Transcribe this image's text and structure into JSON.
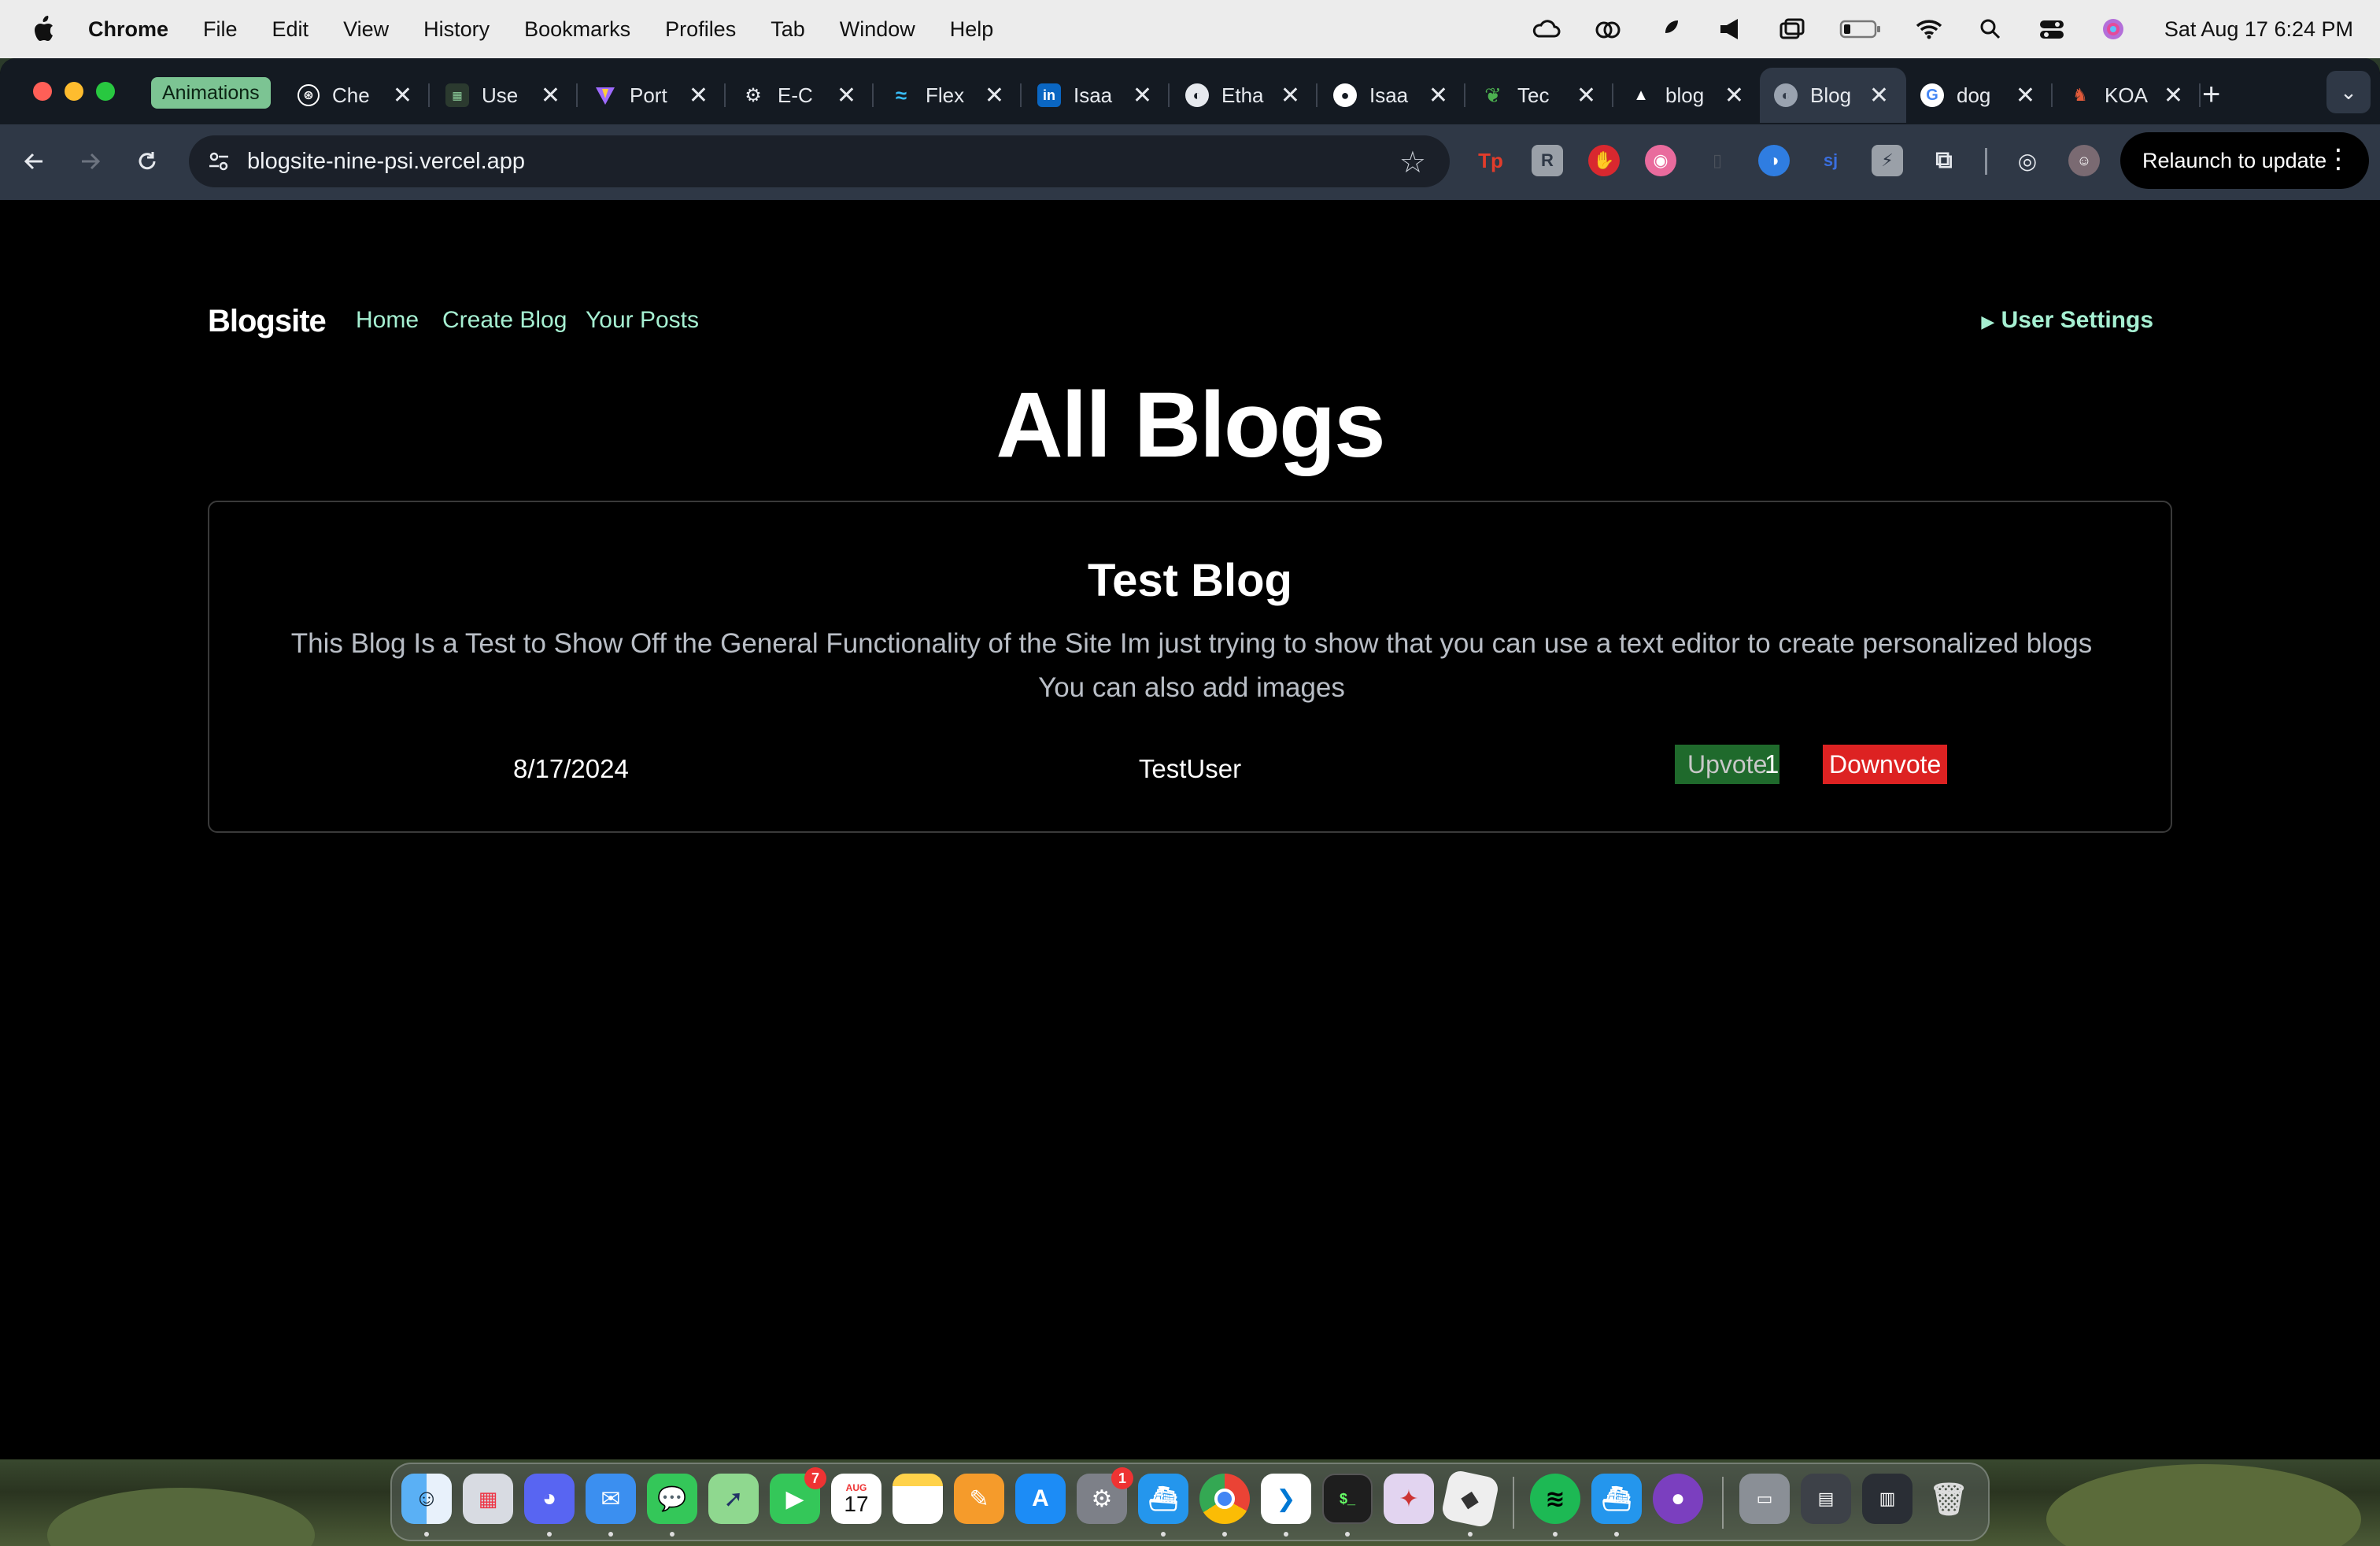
{
  "menubar": {
    "app_name": "Chrome",
    "menus": [
      "File",
      "Edit",
      "View",
      "History",
      "Bookmarks",
      "Profiles",
      "Tab",
      "Window",
      "Help"
    ],
    "clock": "Sat Aug 17  6:24 PM"
  },
  "tabs": {
    "group_label": "Animations",
    "items": [
      {
        "title": "Che",
        "icon": "openai-icon"
      },
      {
        "title": "Use",
        "icon": "spreadsheet-icon"
      },
      {
        "title": "Port",
        "icon": "vite-icon"
      },
      {
        "title": "E-C",
        "icon": "settings-icon"
      },
      {
        "title": "Flex",
        "icon": "tailwind-icon"
      },
      {
        "title": "Isaa",
        "icon": "linkedin-icon"
      },
      {
        "title": "Etha",
        "icon": "globe-icon"
      },
      {
        "title": "Isaa",
        "icon": "github-icon"
      },
      {
        "title": "Tec",
        "icon": "mongodb-icon"
      },
      {
        "title": "blog",
        "icon": "vercel-icon"
      },
      {
        "title": "Blog",
        "icon": "globe-icon",
        "active": true
      },
      {
        "title": "dog",
        "icon": "google-icon"
      },
      {
        "title": "KOA",
        "icon": "koa-icon"
      }
    ]
  },
  "toolbar": {
    "url": "blogsite-nine-psi.vercel.app",
    "relaunch_label": "Relaunch to update"
  },
  "site": {
    "brand": "Blogsite",
    "nav": {
      "home": "Home",
      "create": "Create Blog",
      "posts": "Your Posts"
    },
    "user_settings": "User Settings",
    "page_title": "All Blogs",
    "post": {
      "title": "Test Blog",
      "body_line1": "This Blog Is a Test to Show Off the General Functionality of the Site Im just trying to show that you can use a text editor to create personalized blogs",
      "body_line2": "You can also add images",
      "date": "8/17/2024",
      "author": "TestUser",
      "upvote_label": "Upvote",
      "score": "1",
      "downvote_label": "Downvote"
    }
  },
  "dock": {
    "calendar_month": "AUG",
    "calendar_day": "17",
    "facetime_badge": "7",
    "settings_badge": "1"
  },
  "colors": {
    "link": "#a6f0d2",
    "upvote_bg": "#1f6a2c",
    "downvote_bg": "#dd2222",
    "tab_group": "#7cc493"
  }
}
